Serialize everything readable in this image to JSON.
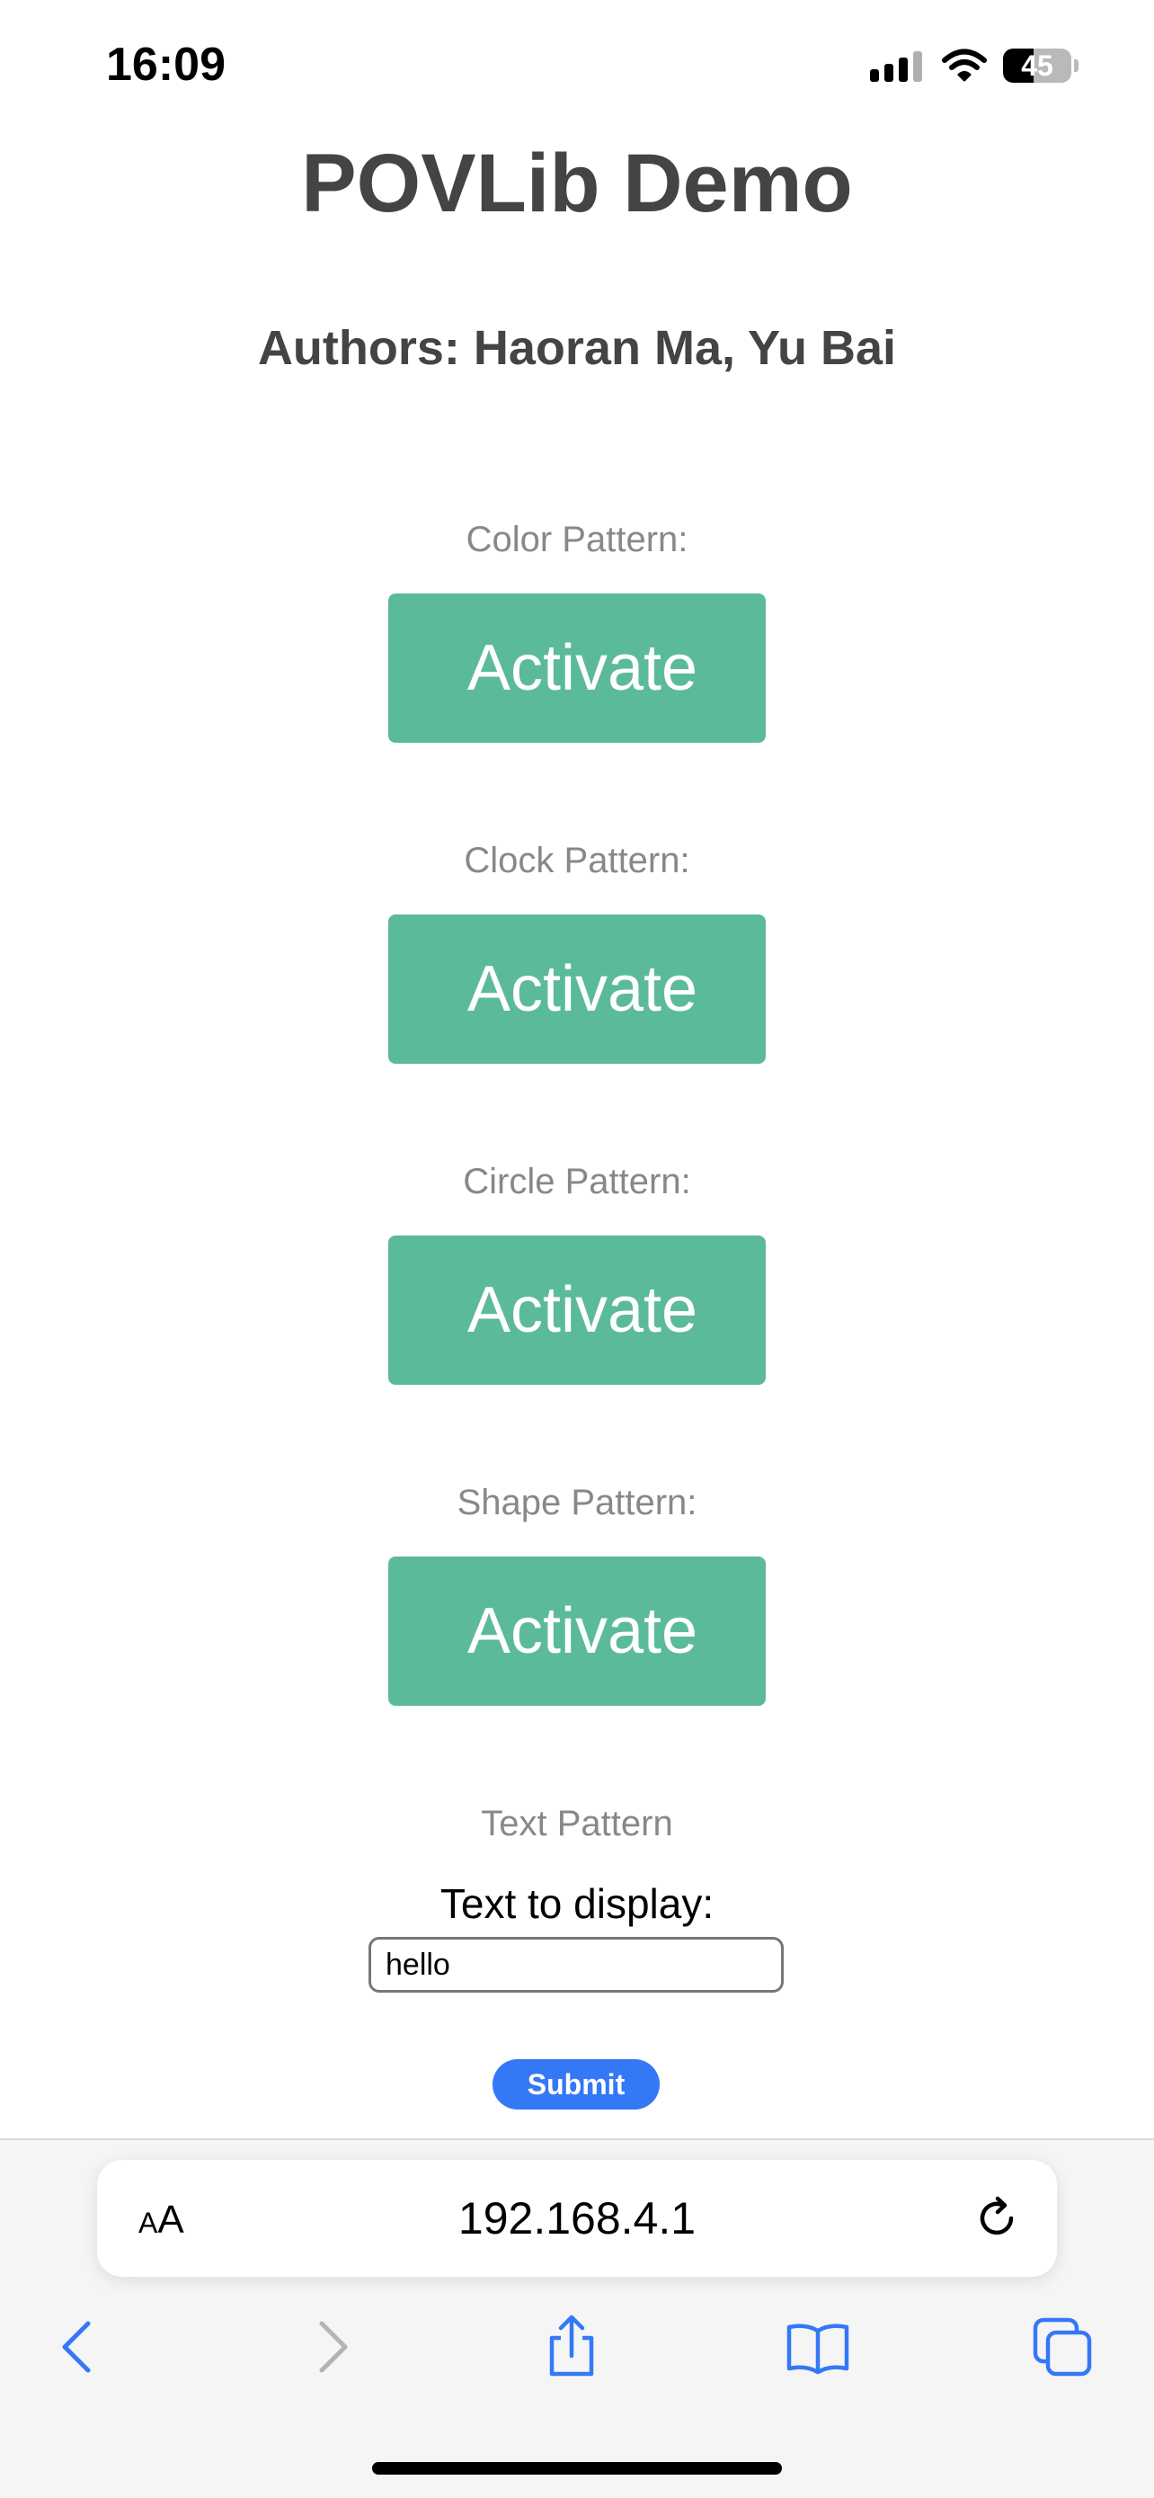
{
  "status_bar": {
    "time": "16:09",
    "battery": "45",
    "battery_level": 0.45,
    "signal_icon": "cellular-signal-icon",
    "wifi_icon": "wifi-icon"
  },
  "page": {
    "title": "POVLib Demo",
    "authors": "Authors: Haoran Ma, Yu Bai",
    "patterns": [
      {
        "label": "Color Pattern:",
        "button": "Activate"
      },
      {
        "label": "Clock Pattern:",
        "button": "Activate"
      },
      {
        "label": "Circle Pattern:",
        "button": "Activate"
      },
      {
        "label": "Shape Pattern:",
        "button": "Activate"
      }
    ],
    "text_pattern": {
      "heading": "Text Pattern",
      "label": "Text to display:",
      "value": "hello",
      "submit": "Submit"
    },
    "button_color": "#5bba9c"
  },
  "browser": {
    "aa_small": "A",
    "aa_large": "A",
    "url": "192.168.4.1",
    "accent": "#3478f6",
    "toolbar_icons": [
      "back-icon",
      "forward-icon",
      "share-icon",
      "bookmarks-icon",
      "tabs-icon"
    ]
  }
}
